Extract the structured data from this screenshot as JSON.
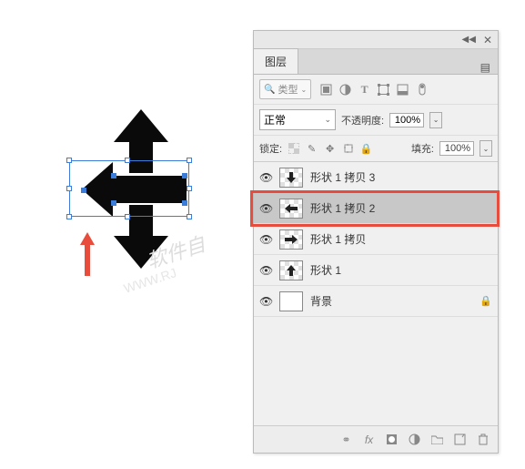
{
  "panel": {
    "tab_label": "图层",
    "type_filter": "类型",
    "blend_mode": "正常",
    "opacity_label": "不透明度:",
    "opacity_value": "100%",
    "lock_label": "锁定:",
    "fill_label": "填充:",
    "fill_value": "100%"
  },
  "layers": [
    {
      "name": "形状 1 拷贝 3",
      "visible": true,
      "selected": false,
      "locked": false
    },
    {
      "name": "形状 1 拷贝 2",
      "visible": true,
      "selected": true,
      "locked": false
    },
    {
      "name": "形状 1 拷贝",
      "visible": true,
      "selected": false,
      "locked": false
    },
    {
      "name": "形状 1",
      "visible": true,
      "selected": false,
      "locked": false
    },
    {
      "name": "背景",
      "visible": true,
      "selected": false,
      "locked": true,
      "bg": true
    }
  ],
  "watermark": {
    "line1": "软件自",
    "line2": "WWW.RJ"
  }
}
